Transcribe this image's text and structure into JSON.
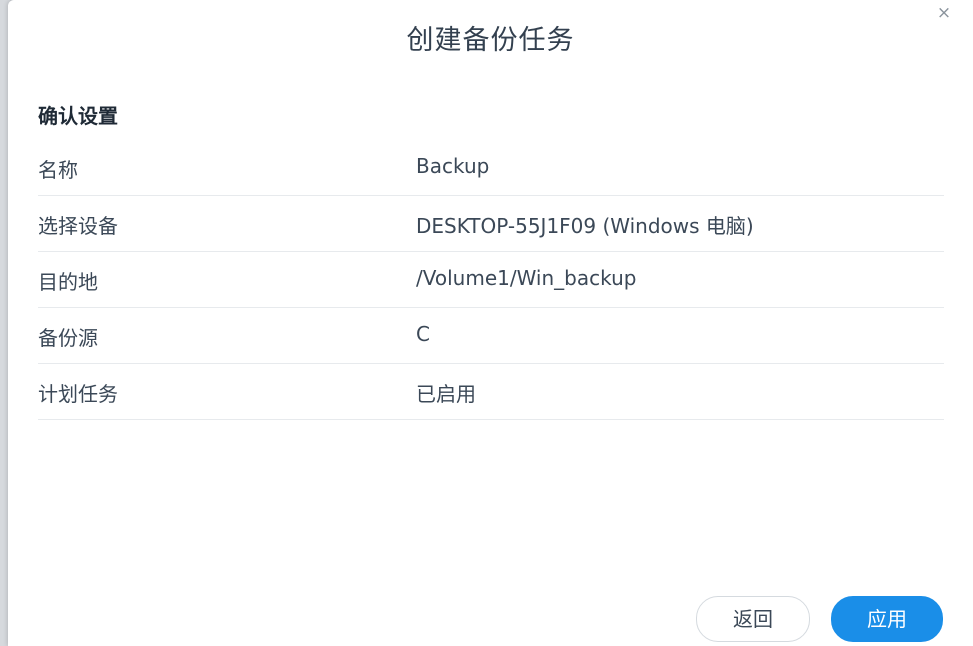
{
  "dialog": {
    "title": "创建备份任务",
    "close_symbol": "×",
    "section_title": "确认设置",
    "rows": [
      {
        "label": "名称",
        "value": "Backup"
      },
      {
        "label": "选择设备",
        "value": "DESKTOP-55J1F09 (Windows 电脑)"
      },
      {
        "label": "目的地",
        "value": "/Volume1/Win_backup"
      },
      {
        "label": "备份源",
        "value": "C"
      },
      {
        "label": "计划任务",
        "value": "已启用"
      }
    ],
    "buttons": {
      "back": "返回",
      "apply": "应用"
    }
  },
  "colors": {
    "accent": "#1a8ee8",
    "text": "#3b4857",
    "title": "#33404f"
  }
}
